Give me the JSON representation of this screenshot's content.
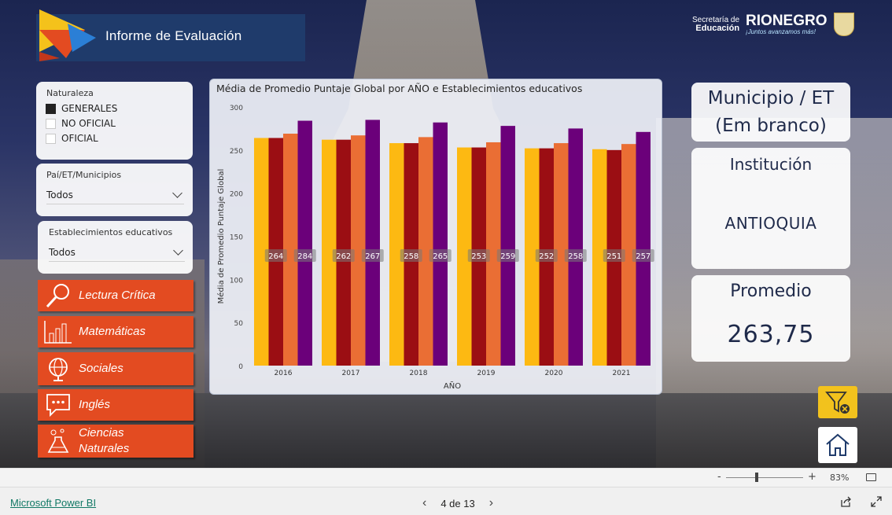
{
  "header": {
    "title": "Informe de Evaluación"
  },
  "brand": {
    "secretaria_line1": "Secretaría de",
    "secretaria_line2": "Educación",
    "name": "RIONEGRO",
    "tagline": "¡Juntos avanzamos más!"
  },
  "filters": {
    "naturaleza": {
      "title": "Naturaleza",
      "options": [
        {
          "label": "GENERALES",
          "checked": true
        },
        {
          "label": "NO OFICIAL",
          "checked": false
        },
        {
          "label": "OFICIAL",
          "checked": false
        }
      ]
    },
    "pais": {
      "title": "Paí/ET/Municipios",
      "value": "Todos"
    },
    "establecimientos": {
      "title": "Establecimientos educativos",
      "value": "Todos"
    }
  },
  "subjects": [
    {
      "label": "Lectura Crítica",
      "icon": "magnifier-icon"
    },
    {
      "label": "Matemáticas",
      "icon": "bar-chart-icon"
    },
    {
      "label": "Sociales",
      "icon": "globe-icon"
    },
    {
      "label": "Inglés",
      "icon": "speech-bubble-icon"
    },
    {
      "label": "Ciencias Naturales",
      "label_line1": "Ciencias",
      "label_line2": "Naturales",
      "icon": "science-icon"
    }
  ],
  "chart_data": {
    "type": "bar",
    "title": "Média de Promedio Puntaje Global por AÑO e Establecimientos educativos",
    "xlabel": "AÑO",
    "ylabel": "Média de Promedio Puntaje Global",
    "ylim": [
      0,
      300
    ],
    "yticks": [
      0,
      50,
      100,
      150,
      200,
      250,
      300
    ],
    "categories": [
      "2016",
      "2017",
      "2018",
      "2019",
      "2020",
      "2021"
    ],
    "series": [
      {
        "color": "#fdb912",
        "values": [
          264,
          262,
          258,
          253,
          252,
          251
        ]
      },
      {
        "color": "#9b0e13",
        "values": [
          264,
          262,
          258,
          253,
          252,
          250
        ]
      },
      {
        "color": "#ea6e34",
        "values": [
          269,
          267,
          265,
          259,
          258,
          257
        ]
      },
      {
        "color": "#6b007a",
        "values": [
          284,
          285,
          282,
          278,
          275,
          271
        ]
      }
    ],
    "data_labels": [
      {
        "category": "2016",
        "labels": [
          "264",
          "284"
        ]
      },
      {
        "category": "2017",
        "labels": [
          "262",
          "267"
        ]
      },
      {
        "category": "2018",
        "labels": [
          "258",
          "265"
        ]
      },
      {
        "category": "2019",
        "labels": [
          "253",
          "259"
        ]
      },
      {
        "category": "2020",
        "labels": [
          "252",
          "258"
        ]
      },
      {
        "category": "2021",
        "labels": [
          "251",
          "257"
        ]
      }
    ],
    "legend": "none",
    "grid": false
  },
  "right_cards": {
    "municipio": {
      "line1": "Municipio / ET",
      "line2": "(Em branco)"
    },
    "institucion": {
      "title": "Institución",
      "value": "ANTIOQUIA"
    },
    "promedio": {
      "title": "Promedio",
      "value": "263,75"
    }
  },
  "zoom": {
    "minus": "-",
    "plus": "+",
    "value": "83%"
  },
  "footer": {
    "link": "Microsoft Power BI",
    "page": "4 de 13"
  },
  "colors": {
    "accent": "#e34b21",
    "header_bg": "#1f3b6b",
    "filter_button": "#f2c21d"
  }
}
